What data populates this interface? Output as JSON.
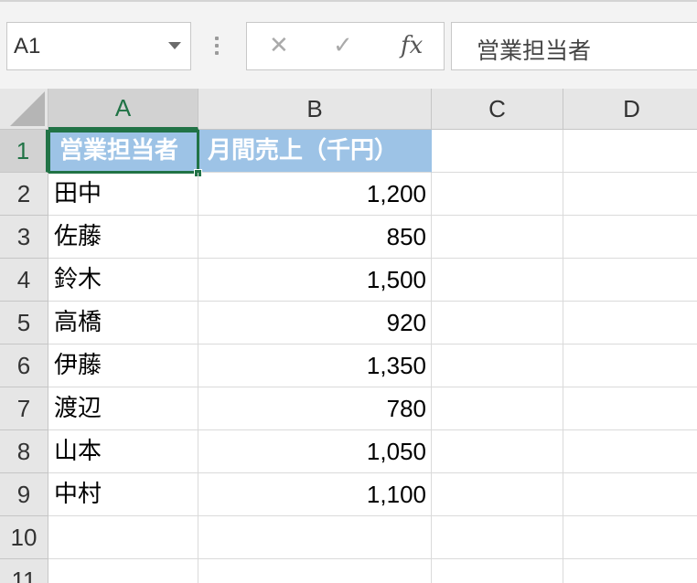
{
  "formula_bar": {
    "name_box": "A1",
    "cancel_icon": "close-icon",
    "enter_icon": "check-icon",
    "function_icon": "fx",
    "formula_value": "営業担当者"
  },
  "columns": [
    "A",
    "B",
    "C",
    "D"
  ],
  "row_numbers": [
    "1",
    "2",
    "3",
    "4",
    "5",
    "6",
    "7",
    "8",
    "9",
    "10",
    "11"
  ],
  "header_row": {
    "a": "営業担当者",
    "b": "月間売上（千円）"
  },
  "rows": [
    {
      "name": "田中",
      "sales": "1,200"
    },
    {
      "name": "佐藤",
      "sales": "850"
    },
    {
      "name": "鈴木",
      "sales": "1,500"
    },
    {
      "name": "高橋",
      "sales": "920"
    },
    {
      "name": "伊藤",
      "sales": "1,350"
    },
    {
      "name": "渡辺",
      "sales": "780"
    },
    {
      "name": "山本",
      "sales": "1,050"
    },
    {
      "name": "中村",
      "sales": "1,100"
    }
  ],
  "colors": {
    "accent": "#217346",
    "header_fill": "#9dc3e6"
  }
}
